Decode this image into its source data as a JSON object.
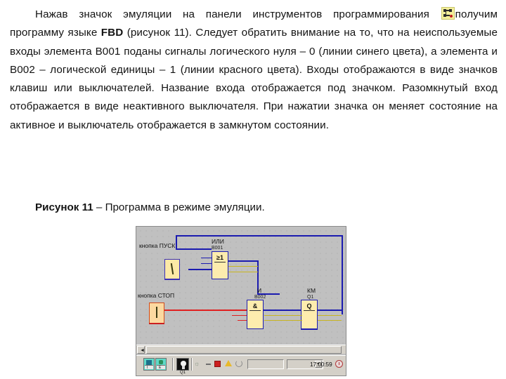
{
  "document": {
    "paragraph_runs": [
      {
        "text": "Нажав значок эмуляции на панели инструментов программирования ",
        "bold": false
      },
      {
        "text": "получим программу языке ",
        "bold": false
      },
      {
        "text": "FBD",
        "bold": true
      },
      {
        "text": " (рисунок 11). Следует обратить внимание на то, что на неиспользуемые входы элемента B001 поданы сигналы логического нуля – 0 (линии синего цвета), а элемента и B002 – логической единицы – 1 (линии красного цвета). Входы отображаются в виде значков клавиш или выключателей. Название входа отображается под значком. Разомкнутый вход отображается в виде неактивного выключателя. При нажатии значка он меняет состояние на активное и выключатель отображается в замкнутом состоянии.",
        "bold": false
      }
    ],
    "paragraph_text_part1": "Нажав значок эмуляции на панели инструментов программирования ",
    "paragraph_text_part2": "получим программу языке ",
    "paragraph_bold_fbd": "FBD",
    "paragraph_text_part3": " (рисунок 11). Следует обратить внимание на то, что на неиспользуемые входы элемента B001 поданы сигналы логического нуля – 0 (линии синего цвета), а элемента и B002 – логической единицы – 1 (линии красного цвета). Входы отображаются в виде значков клавиш или выключателей. Название входа отображается под значком. Разомкнутый вход отображается в виде неактивного выключателя. При нажатии значка он меняет состояние на активное и выключатель отображается в замкнутом состоянии.",
    "figure_caption_bold": "Рисунок 11",
    "figure_caption_rest": " – Программа в режиме эмуляции.",
    "emulation_icon_name": "emulation-toolbar-icon"
  },
  "screenshot": {
    "canvas": {
      "labels": {
        "start_button": "кнопка ПУСК",
        "stop_button": "кнопка СТОП"
      },
      "blocks": [
        {
          "id": "B001",
          "title": "ИЛИ",
          "name": "B001",
          "symbol": "≥1",
          "type": "or"
        },
        {
          "id": "B002",
          "title": "И",
          "name": "B002",
          "symbol": "&",
          "type": "and"
        },
        {
          "id": "Q1",
          "title": "КМ",
          "name": "Q1",
          "symbol": "Q",
          "type": "output"
        }
      ],
      "wire_colors": {
        "logic_zero": "#1b1bb0",
        "logic_one": "#e02020",
        "unconnected": "#c8b520"
      }
    },
    "scrollbar": {
      "left_arrow": "◄"
    },
    "statusbar": {
      "tool_left_label": "I",
      "tool_right_label": "E",
      "lamp_label": "Q1",
      "combo_value": "",
      "clock": "17:00:59",
      "icons": {
        "glasses": "glasses-icon",
        "dash": "dash-icon",
        "stop": "stop-icon",
        "warning": "warning-icon",
        "refresh": "refresh-icon",
        "clock": "clock-icon"
      }
    }
  }
}
